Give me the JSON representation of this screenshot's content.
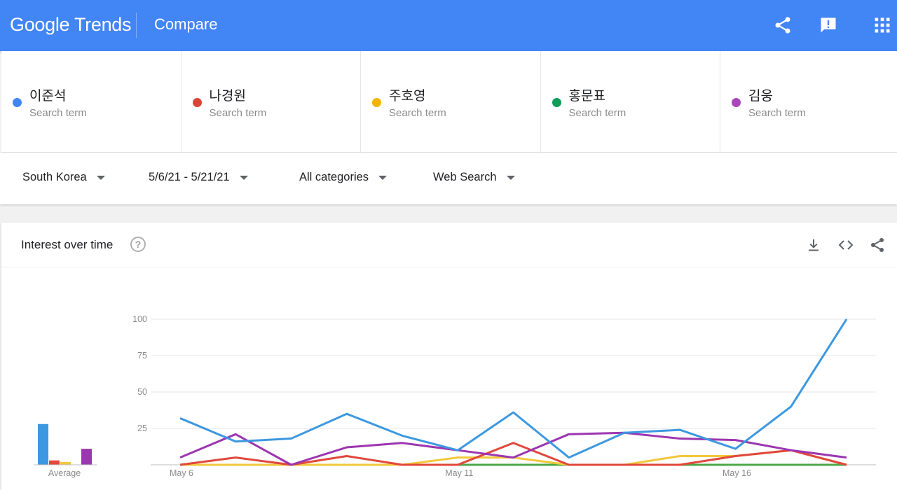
{
  "header": {
    "logo_google": "Google",
    "logo_trends": "Trends",
    "page_title": "Compare",
    "icons": [
      "share-icon",
      "feedback-icon",
      "apps-grid-icon"
    ]
  },
  "terms": [
    {
      "name": "이준석",
      "sub": "Search term",
      "color": "#4285f4"
    },
    {
      "name": "나경원",
      "sub": "Search term",
      "color": "#db4437"
    },
    {
      "name": "주호영",
      "sub": "Search term",
      "color": "#f4b400"
    },
    {
      "name": "홍문표",
      "sub": "Search term",
      "color": "#0f9d58"
    },
    {
      "name": "김웅",
      "sub": "Search term",
      "color": "#ab47bc"
    }
  ],
  "filters": {
    "region": "South Korea",
    "date_range": "5/6/21 - 5/21/21",
    "category": "All categories",
    "search_type": "Web Search"
  },
  "card": {
    "title": "Interest over time",
    "help": "?",
    "icons": [
      "download-icon",
      "embed-code-icon",
      "share-icon"
    ]
  },
  "chart_data": {
    "type": "line",
    "x_tick_labels": [
      "May 6",
      "May 11",
      "May 16"
    ],
    "x_tick_indices": [
      0,
      5,
      10
    ],
    "y_ticks": [
      25,
      50,
      75,
      100
    ],
    "ylim": [
      0,
      100
    ],
    "grid": true,
    "average_label": "Average",
    "series": [
      {
        "name": "이준석",
        "color": "#3c98e0",
        "values": [
          32,
          16,
          18,
          35,
          20,
          10,
          36,
          5,
          22,
          24,
          11,
          40,
          100
        ],
        "average": 28
      },
      {
        "name": "나경원",
        "color": "#e0483c",
        "values": [
          0,
          5,
          0,
          6,
          0,
          0,
          15,
          0,
          0,
          0,
          6,
          10,
          0
        ],
        "average": 3
      },
      {
        "name": "주호영",
        "color": "#f2c83c",
        "values": [
          0,
          0,
          0,
          0,
          0,
          5,
          5,
          0,
          0,
          6,
          6,
          10,
          0
        ],
        "average": 2
      },
      {
        "name": "홍문표",
        "color": "#4ca848",
        "values": [
          0,
          0,
          0,
          0,
          0,
          0,
          0,
          0,
          0,
          0,
          0,
          0,
          0
        ],
        "average": 0
      },
      {
        "name": "김웅",
        "color": "#9c36b0",
        "values": [
          5,
          21,
          0,
          12,
          15,
          10,
          5,
          21,
          22,
          18,
          17,
          10,
          5
        ],
        "average": 11
      }
    ]
  }
}
